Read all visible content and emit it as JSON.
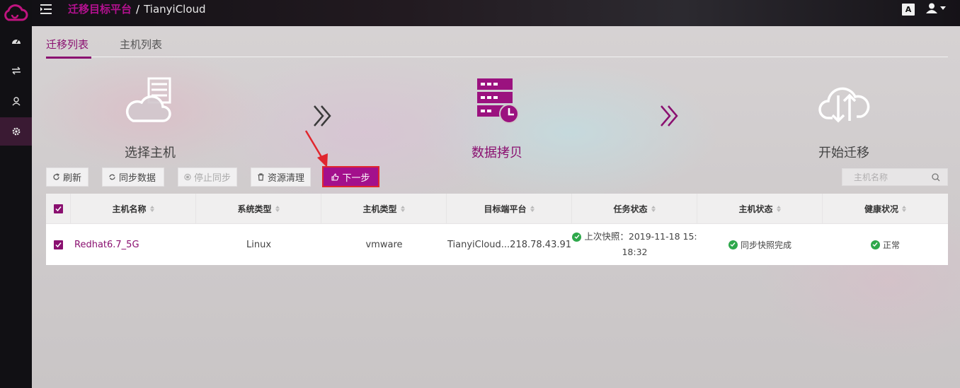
{
  "header": {
    "breadcrumb_primary": "迁移目标平台",
    "breadcrumb_sep": "/",
    "breadcrumb_secondary": "TianyiCloud",
    "lang_label": "A"
  },
  "tabs": [
    {
      "label": "迁移列表",
      "active": true
    },
    {
      "label": "主机列表",
      "active": false
    }
  ],
  "steps": [
    {
      "label": "选择主机",
      "icon": "cloud-server-icon"
    },
    {
      "label": "数据拷贝",
      "icon": "server-clock-icon",
      "active": true
    },
    {
      "label": "开始迁移",
      "icon": "cloud-transfer-icon"
    }
  ],
  "toolbar": {
    "refresh": "刷新",
    "sync_data": "同步数据",
    "stop_sync": "停止同步",
    "cleanup": "资源清理",
    "next_step": "下一步"
  },
  "search": {
    "placeholder": "主机名称"
  },
  "table": {
    "columns": [
      "主机名称",
      "系统类型",
      "主机类型",
      "目标端平台",
      "任务状态",
      "主机状态",
      "健康状况"
    ],
    "rows": [
      {
        "name": "Redhat6.7_5G",
        "os": "Linux",
        "host_type": "vmware",
        "target_platform": "TianyiCloud...218.78.43.91",
        "task_status_line1": "上次快照：2019-11-18 15:",
        "task_status_line2": "18:32",
        "host_status": "同步快照完成",
        "health": "正常"
      }
    ]
  },
  "colors": {
    "accent": "#8a1070",
    "button_active": "#a3108c",
    "highlight_border": "#e0262e",
    "success": "#2ea84b"
  }
}
